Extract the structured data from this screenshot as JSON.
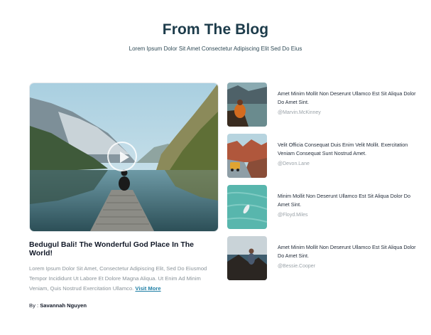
{
  "header": {
    "title": "From The Blog",
    "subtitle": "Lorem Ipsum Dolor Sit Amet Consectetur Adipiscing Elit Sed Do Eius"
  },
  "featured": {
    "title": "Bedugul Bali! The Wonderful God Place In The World!",
    "excerpt": "Lorem Ipsum Dolor Sit Amet, Consectetur Adipiscing Elit, Sed Do Eiusmod Tempor Incididunt Ut Labore Et Dolore Magna Aliqua. Ut Enim Ad Minim Veniam, Quis Nostrud Exercitation Ullamco.",
    "link_label": "Visit More",
    "byline_prefix": "By : ",
    "author": "Savannah Nguyen",
    "image_icon": "lake-mountain-image",
    "play_icon": "play-icon"
  },
  "posts": [
    {
      "title": "Amet Minim Mollit Non Deserunt Ullamco Est Sit Aliqua Dolor Do Amet Sint.",
      "author": "@Marvin.McKinney"
    },
    {
      "title": "Velit Officia Consequat Duis Enim Velit Mollit. Exercitation Veniam Consequat Sunt Nostrud Amet.",
      "author": "@Devon.Lane"
    },
    {
      "title": "Minim Mollit Non Deserunt Ullamco Est Sit Aliqua Dolor Do Amet Sint.",
      "author": "@Floyd.Miles"
    },
    {
      "title": "Amet Minim Mollit Non Deserunt Ullamco Est Sit Aliqua Dolor Do Amet Sint.",
      "author": "@Bessie.Cooper"
    }
  ],
  "colors": {
    "title": "#1c3b4a",
    "link": "#1f7fa5",
    "muted": "#8a9399"
  }
}
